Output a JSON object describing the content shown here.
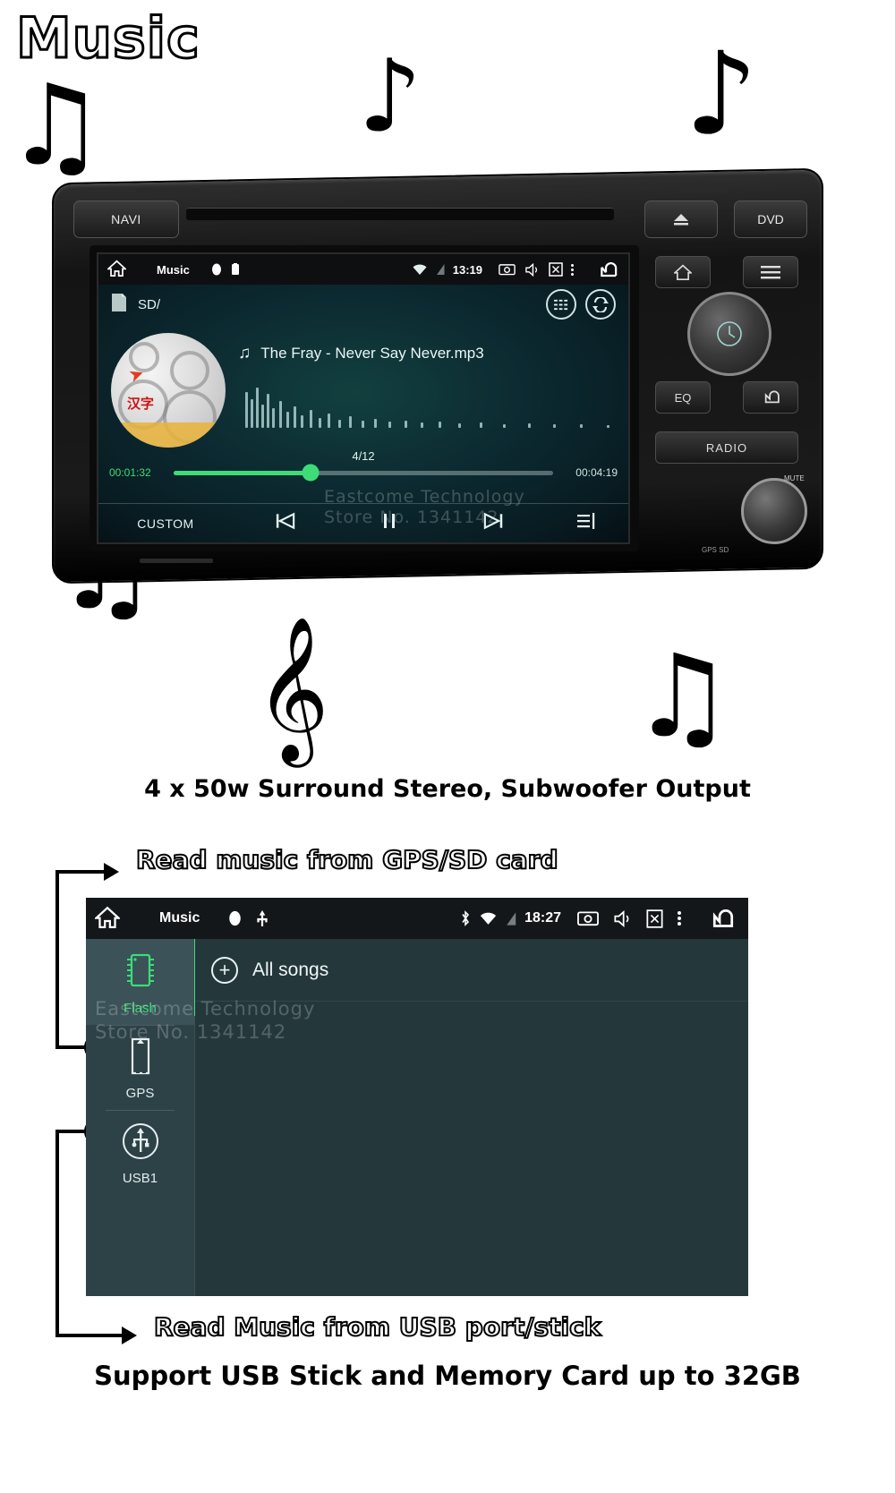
{
  "page": {
    "title": "Music",
    "tagline": "4 x 50w Surround Stereo, Subwoofer Output",
    "callout_top": "Read music from GPS/SD card",
    "callout_bottom": "Read Music from USB port/stick",
    "caption_final": "Support USB Stick and Memory Card up to 32GB",
    "watermark_line1": "Eastcome Technology",
    "watermark_line2": "Store No. 1341142"
  },
  "device": {
    "navi_label": "NAVI",
    "eject_label": "⏏",
    "dvd_label": "DVD",
    "cluster": {
      "home_icon": "home-icon",
      "menu_icon": "menu-icon",
      "eq_label": "EQ",
      "back_icon": "back-arrow-icon",
      "radio_label": "RADIO",
      "mute_label": "MUTE",
      "gps_sd_label": "GPS  SD"
    }
  },
  "player": {
    "status_bar": {
      "home_icon": "home-icon",
      "title": "Music",
      "sd_icon": "sd-card-icon",
      "usb_icon": "usb-icon",
      "wifi_icon": "wifi-icon",
      "signal_icon": "signal-icon",
      "time": "13:19",
      "camera_icon": "camera-icon",
      "volume_icon": "volume-icon",
      "close_icon": "close-box-icon",
      "more_icon": "more-dots-icon",
      "back_icon": "back-arrow-icon"
    },
    "path": "SD/",
    "eq_button": "equalizer-icon",
    "repeat_button": "repeat-icon",
    "track_title": "The Fray - Never Say Never.mp3",
    "track_counter": "4/12",
    "time_elapsed": "00:01:32",
    "time_total": "00:04:19",
    "progress_percent": 36,
    "controls": {
      "custom": "CUSTOM",
      "prev": "⏮",
      "pause": "⏸",
      "next": "⏭",
      "playlist": "playlist-icon"
    },
    "accent_color": "#3ddc77"
  },
  "browser": {
    "status_bar": {
      "home_icon": "home-icon",
      "title": "Music",
      "sd_icon": "sd-card-icon",
      "usb_icon": "usb-icon",
      "bluetooth_icon": "bluetooth-icon",
      "wifi_icon": "wifi-icon",
      "signal_icon": "signal-icon",
      "time": "18:27",
      "camera_icon": "camera-icon",
      "volume_icon": "volume-icon",
      "close_icon": "close-box-icon",
      "more_icon": "more-dots-icon",
      "back_icon": "back-arrow-icon"
    },
    "sources": [
      {
        "label": "Flash",
        "icon": "chip-icon",
        "selected": true
      },
      {
        "label": "GPS",
        "icon": "sd-card-icon",
        "selected": false
      },
      {
        "label": "USB1",
        "icon": "usb-icon",
        "selected": false
      }
    ],
    "all_songs": "All songs",
    "add_icon": "plus-circle-icon"
  }
}
